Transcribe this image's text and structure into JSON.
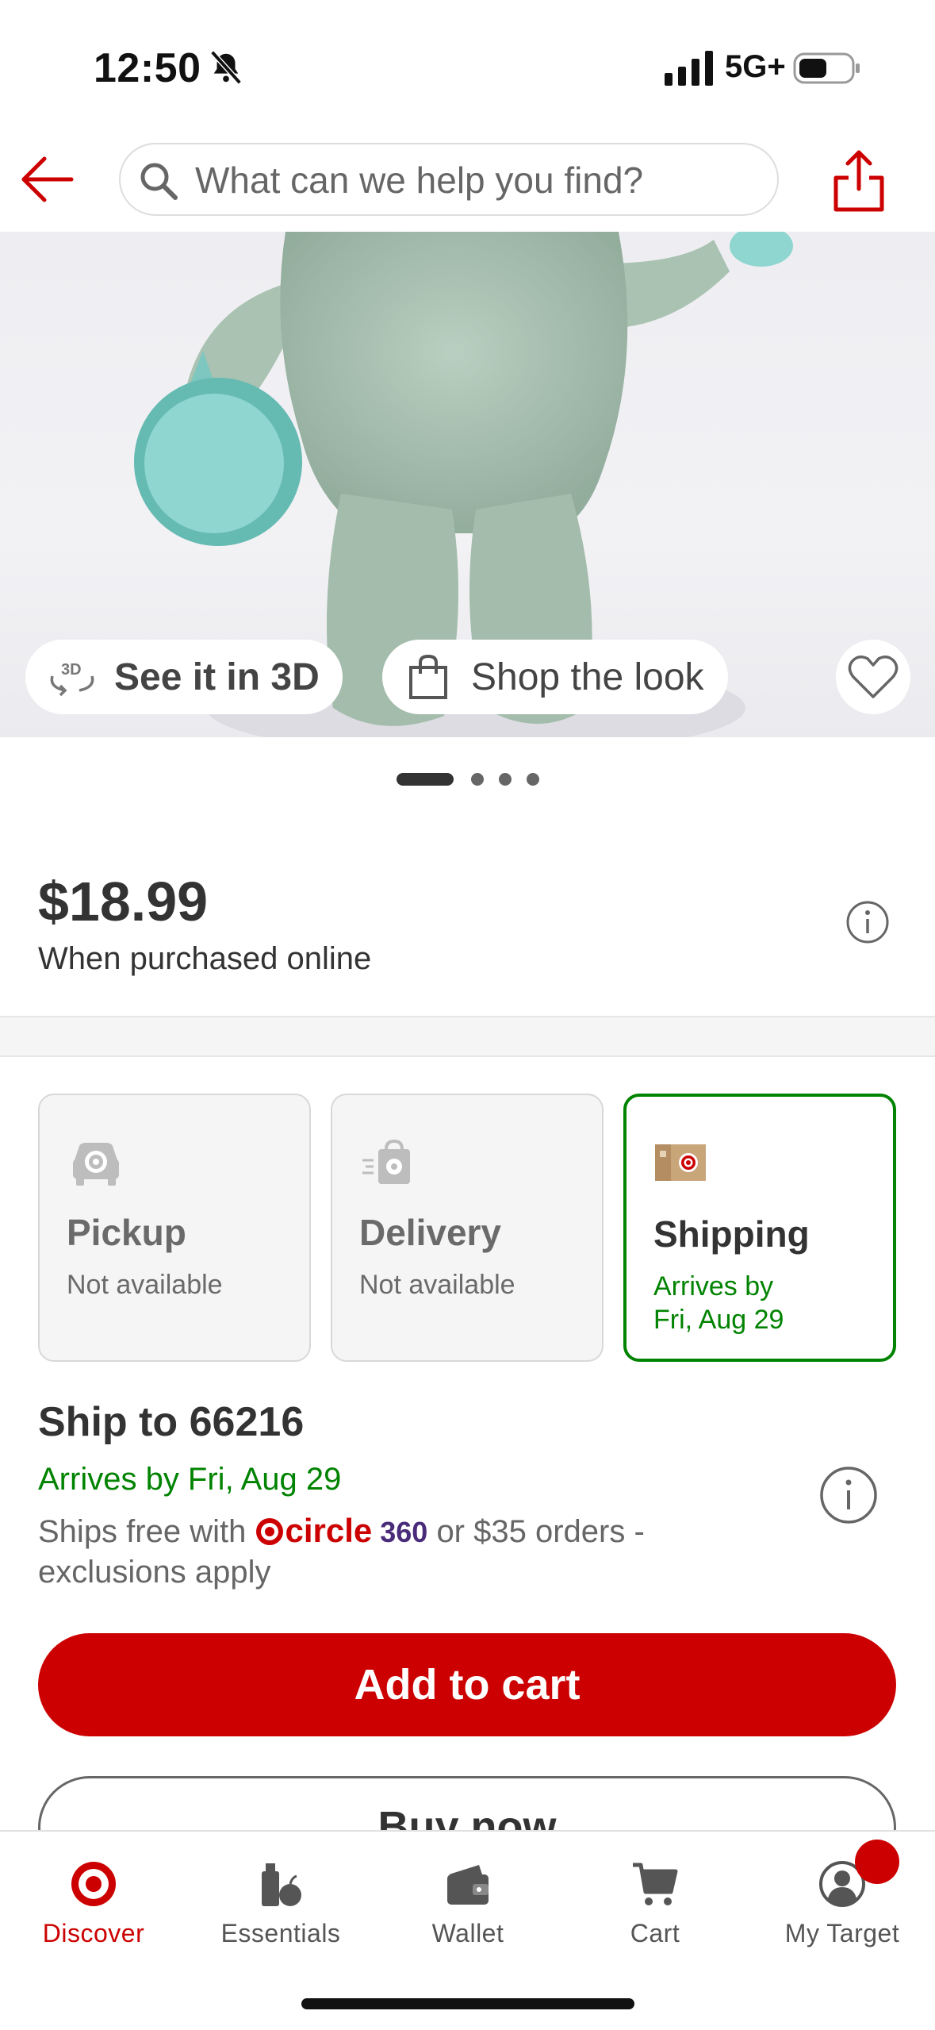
{
  "status_bar": {
    "time": "12:50",
    "network": "5G+"
  },
  "header": {
    "search_placeholder": "What can we help you find?"
  },
  "hero": {
    "see_3d_label": "See it in 3D",
    "shop_look_label": "Shop the look",
    "dots_count": 4,
    "active_dot": 1
  },
  "price": {
    "amount": "$18.99",
    "note": "When purchased online"
  },
  "fulfillment": [
    {
      "title": "Pickup",
      "subtitle": "Not available",
      "available": false,
      "icon": "pickup-icon"
    },
    {
      "title": "Delivery",
      "subtitle": "Not available",
      "available": false,
      "icon": "delivery-icon"
    },
    {
      "title": "Shipping",
      "subtitle_line1": "Arrives by",
      "subtitle_line2": "Fri, Aug 29",
      "available": true,
      "icon": "shipping-box-icon"
    }
  ],
  "shipping": {
    "ship_to": "Ship to 66216",
    "arrives": "Arrives by Fri, Aug 29",
    "ships_free_prefix": "Ships free with",
    "circle_text": "circle",
    "circle_360": "360",
    "ships_free_suffix": "or $35 orders -",
    "exclusions": "exclusions apply"
  },
  "buttons": {
    "add_to_cart": "Add to cart",
    "buy_now": "Buy now"
  },
  "tabs": [
    {
      "label": "Discover",
      "icon": "target-logo-icon",
      "active": true
    },
    {
      "label": "Essentials",
      "icon": "essentials-icon",
      "active": false
    },
    {
      "label": "Wallet",
      "icon": "wallet-icon",
      "active": false
    },
    {
      "label": "Cart",
      "icon": "cart-icon",
      "active": false
    },
    {
      "label": "My Target",
      "icon": "account-icon",
      "active": false
    }
  ],
  "colors": {
    "brand_red": "#cc0000",
    "success_green": "#008300",
    "circle_purple": "#4a2c7a"
  }
}
